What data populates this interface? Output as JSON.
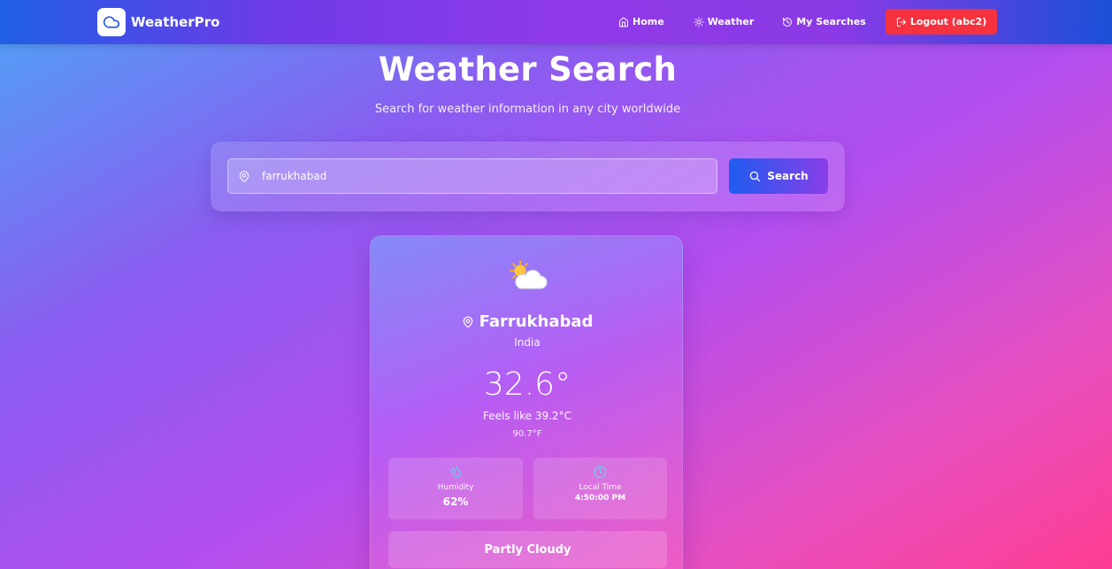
{
  "nav": {
    "brand": "WeatherPro",
    "links": {
      "home": "Home",
      "weather": "Weather",
      "searches": "My Searches"
    },
    "logout": "Logout (abc2)"
  },
  "header": {
    "title": "Weather Search",
    "subtitle": "Search for weather information in any city worldwide"
  },
  "search": {
    "value": "farrukhabad",
    "button": "Search"
  },
  "weather": {
    "city": "Farrukhabad",
    "country": "India",
    "temperature": "32.6°",
    "feels_like": "Feels like 39.2°C",
    "fahrenheit": "90.7°F",
    "humidity_label": "Humidity",
    "humidity_value": "62%",
    "time_label": "Local Time",
    "time_value": "4:50:00 PM",
    "condition": "Partly Cloudy",
    "icon": "partly-cloudy-icon"
  },
  "colors": {
    "accent_blue": "#1e5cf0",
    "accent_purple": "#8a3ee8",
    "logout_red": "#f5323e",
    "stat_icon": "#5fd4e8"
  }
}
